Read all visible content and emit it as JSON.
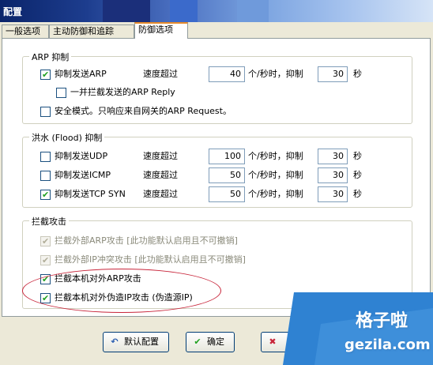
{
  "window": {
    "title": "配置"
  },
  "tabs": [
    {
      "label": "一般选项",
      "active": false
    },
    {
      "label": "主动防御和追踪",
      "active": false
    },
    {
      "label": "防御选项",
      "active": true
    }
  ],
  "arp_group": {
    "title": "ARP 抑制",
    "suppress_arp": {
      "label": "抑制发送ARP",
      "checked": true,
      "speed_label": "速度超过",
      "rate": "40",
      "unit": "个/秒时，抑制",
      "duration": "30",
      "sec": "秒"
    },
    "block_reply": {
      "label": "一并拦截发送的ARP Reply",
      "checked": false
    },
    "safe_mode": {
      "label": "安全模式。只响应来自网关的ARP Request。",
      "checked": false
    }
  },
  "flood_group": {
    "title": "洪水 (Flood) 抑制",
    "rows": [
      {
        "label": "抑制发送UDP",
        "checked": false,
        "speed_label": "速度超过",
        "rate": "100",
        "unit": "个/秒时，抑制",
        "duration": "30",
        "sec": "秒"
      },
      {
        "label": "抑制发送ICMP",
        "checked": false,
        "speed_label": "速度超过",
        "rate": "50",
        "unit": "个/秒时，抑制",
        "duration": "30",
        "sec": "秒"
      },
      {
        "label": "抑制发送TCP SYN",
        "checked": true,
        "speed_label": "速度超过",
        "rate": "50",
        "unit": "个/秒时，抑制",
        "duration": "30",
        "sec": "秒"
      }
    ]
  },
  "block_group": {
    "title": "拦截攻击",
    "items": [
      {
        "label": "拦截外部ARP攻击 [此功能默认启用且不可撤销]",
        "checked": true,
        "disabled": true
      },
      {
        "label": "拦截外部IP冲突攻击 [此功能默认启用且不可撤销]",
        "checked": true,
        "disabled": true
      },
      {
        "label": "拦截本机对外ARP攻击",
        "checked": true,
        "disabled": false
      },
      {
        "label": "拦截本机对外伪造IP攻击 (伪造源IP)",
        "checked": true,
        "disabled": false
      }
    ]
  },
  "buttons": {
    "default": "默认配置",
    "ok": "确定"
  },
  "watermark": {
    "cn": "格子啦",
    "en": "gezila.com"
  },
  "colors": {
    "title_bar": "#0a246a",
    "accent_tab": "#e68b2c",
    "highlight": "#c8253a",
    "check": "#21a121"
  }
}
